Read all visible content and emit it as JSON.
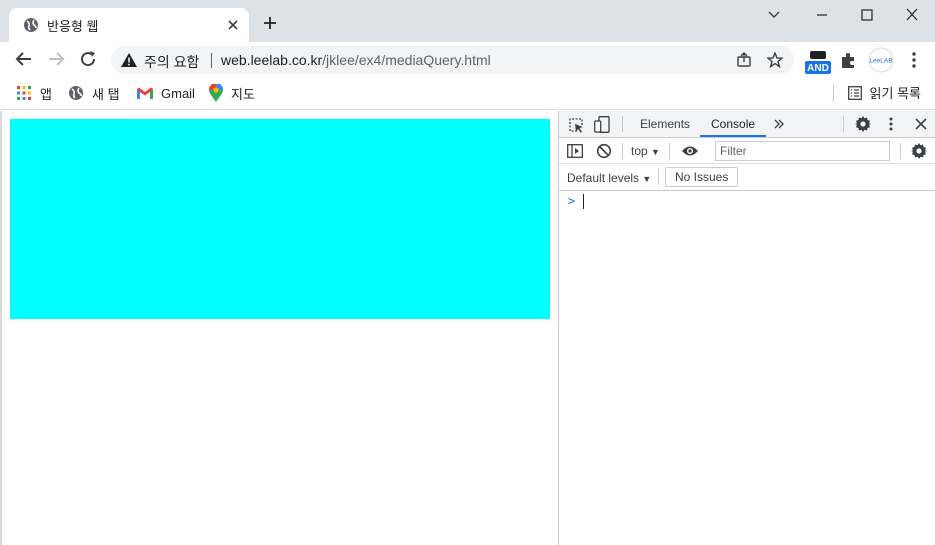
{
  "browser": {
    "tab_title": "반응형 웹",
    "warning_text": "주의 요함",
    "url_host": "web.leelab.co.kr",
    "url_path": "/jklee/ex4/mediaQuery.html"
  },
  "extensions": {
    "and_badge": "AND",
    "leelab_badge": "LeeLAB"
  },
  "bookmarks": {
    "items": [
      "앱",
      "새 탭",
      "Gmail",
      "지도"
    ],
    "reading_list": "읽기 목록"
  },
  "page": {
    "box_color": "#00ffff"
  },
  "devtools": {
    "tabs": [
      "Elements",
      "Console"
    ],
    "active_tab": "Console",
    "context": "top",
    "filter_placeholder": "Filter",
    "levels": "Default levels",
    "issues": "No Issues",
    "prompt": ">"
  }
}
